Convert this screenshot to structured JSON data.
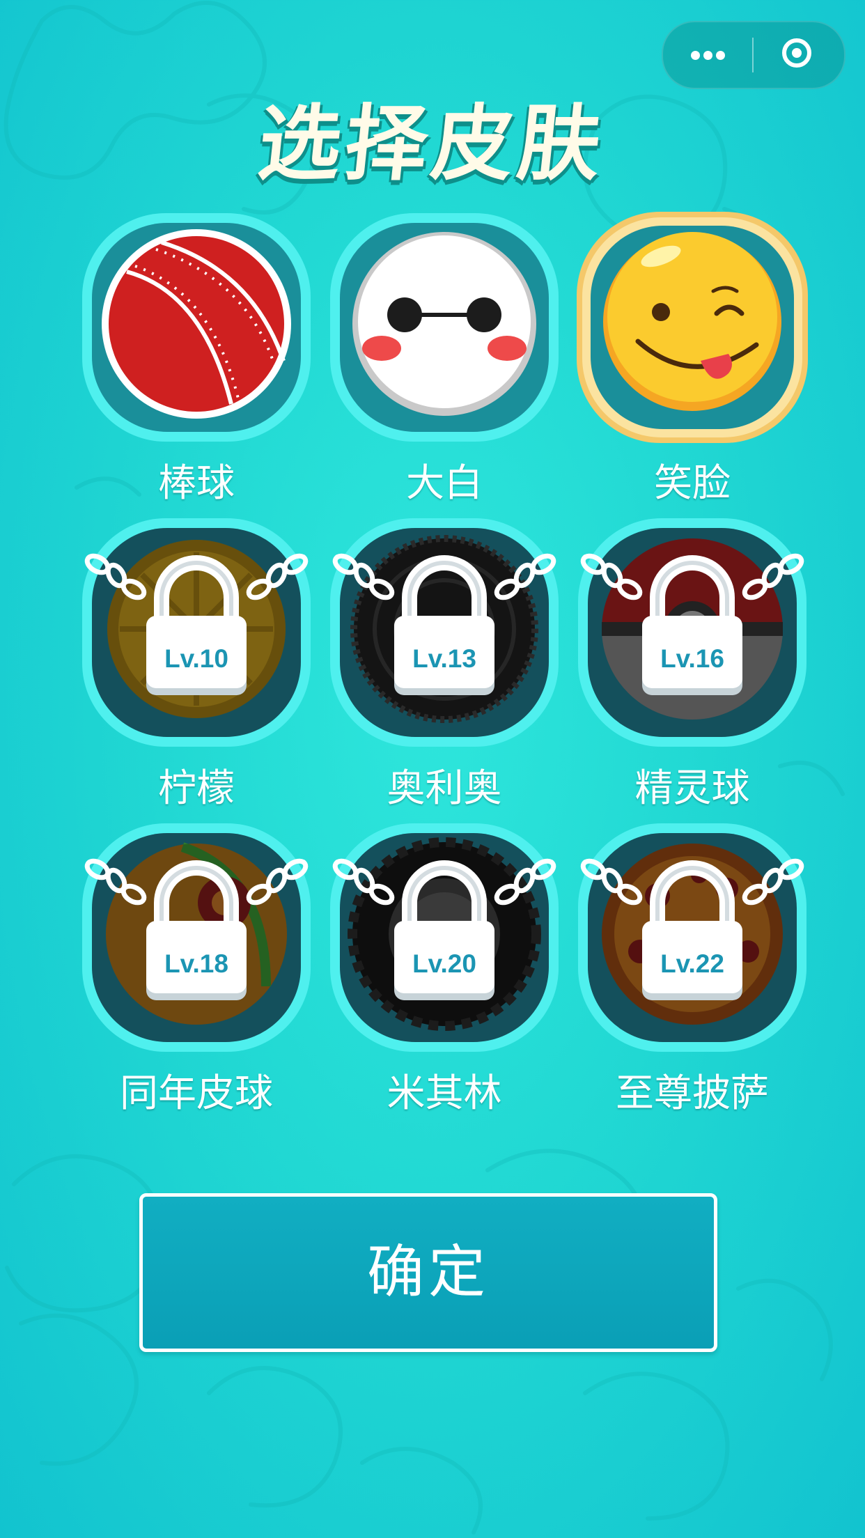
{
  "title": "选择皮肤",
  "capsule": {
    "more_icon": "more-dots-icon",
    "close_icon": "close-target-icon"
  },
  "colors": {
    "background": "#21d8d3",
    "tile_ring": "#4ff0ee",
    "tile_inner": "#1a7f8c",
    "selected_ring": "#f7d98a",
    "button": "#0aa8bf",
    "lock_text": "#1b95b3"
  },
  "skins": [
    {
      "name": "棒球",
      "locked": false,
      "selected": false,
      "icon": "baseball-icon"
    },
    {
      "name": "大白",
      "locked": false,
      "selected": false,
      "icon": "baymax-icon"
    },
    {
      "name": "笑脸",
      "locked": false,
      "selected": true,
      "icon": "smiley-icon"
    },
    {
      "name": "柠檬",
      "locked": true,
      "level": "Lv.10",
      "icon": "lemon-icon"
    },
    {
      "name": "奥利奥",
      "locked": true,
      "level": "Lv.13",
      "icon": "oreo-icon"
    },
    {
      "name": "精灵球",
      "locked": true,
      "level": "Lv.16",
      "icon": "pokeball-icon"
    },
    {
      "name": "同年皮球",
      "locked": true,
      "level": "Lv.18",
      "icon": "rubber-ball-icon"
    },
    {
      "name": "米其林",
      "locked": true,
      "level": "Lv.20",
      "icon": "tire-icon"
    },
    {
      "name": "至尊披萨",
      "locked": true,
      "level": "Lv.22",
      "icon": "pizza-icon"
    }
  ],
  "confirm_label": "确定"
}
